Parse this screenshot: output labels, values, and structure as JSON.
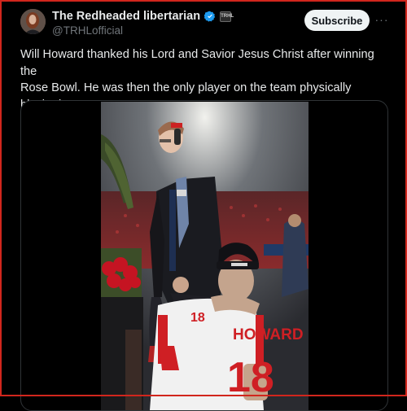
{
  "author": {
    "display_name": "The Redheaded libertarian",
    "handle": "@TRHLofficial",
    "affiliate_badge_text": "TRHL"
  },
  "actions": {
    "subscribe_label": "Subscribe",
    "more_label": "···"
  },
  "tweet": {
    "text": "Will Howard thanked his Lord and Savior Jesus Christ after winning the\nRose Bowl. He was then the only player on the team physically blocked\nfrom going on stage."
  },
  "media": {
    "jersey_name": "HOWARD",
    "jersey_number": "18"
  },
  "colors": {
    "background": "#000000",
    "verified_blue": "#1d9bf0",
    "subscribe_bg": "#eff3f4",
    "frame_border": "#d1261d",
    "ohio_state_scarlet": "#bb0000"
  },
  "icons": {
    "verified": "verified-badge-icon",
    "affiliate": "affiliate-badge-icon",
    "more": "more-options-icon"
  }
}
